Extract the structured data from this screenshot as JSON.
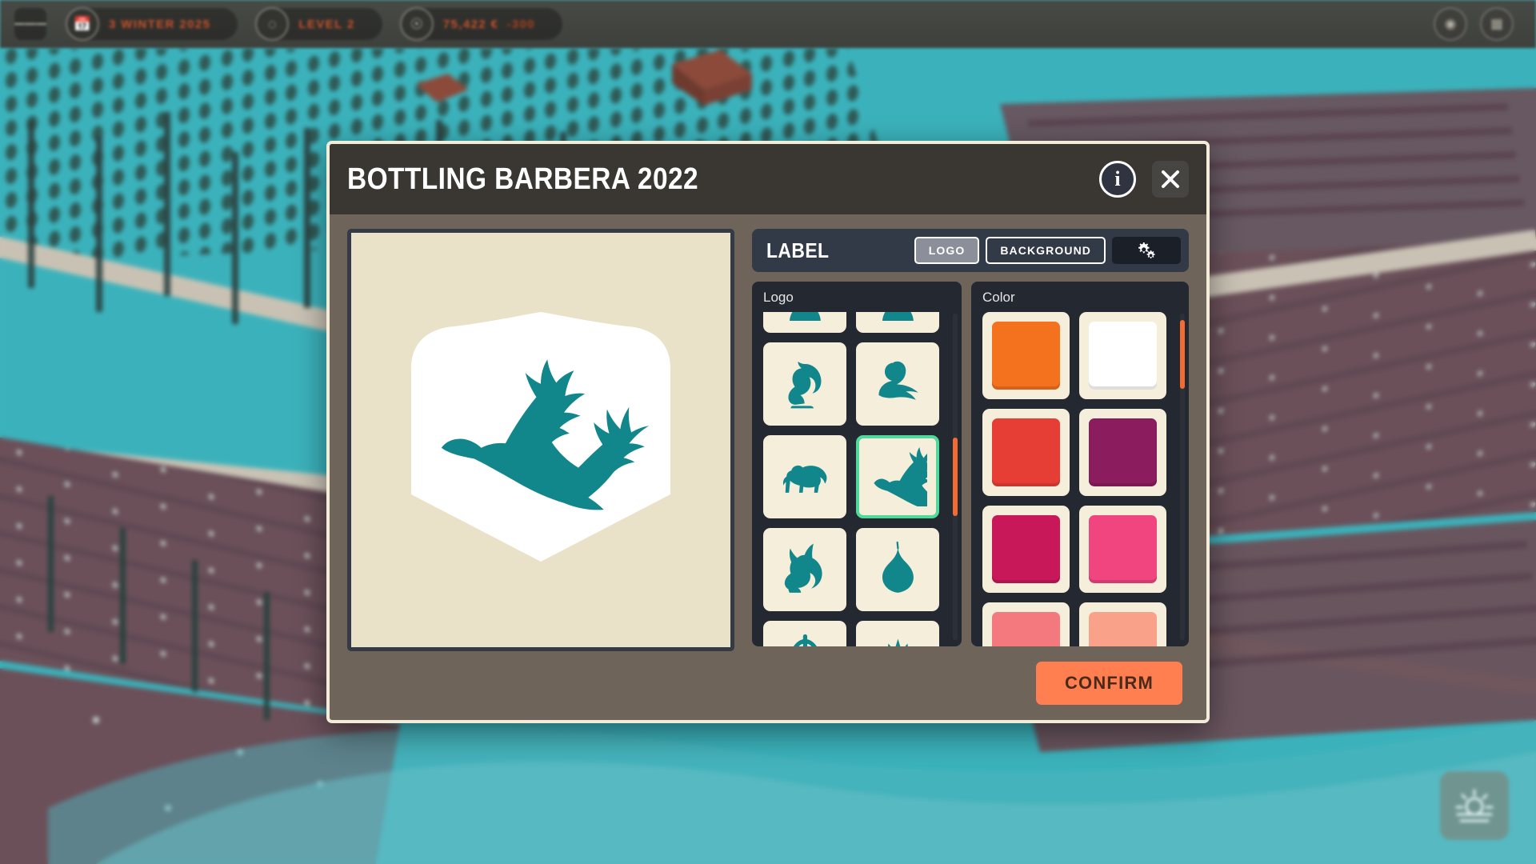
{
  "hud": {
    "menu_icon": "hamburger-menu-icon",
    "chips": [
      {
        "icon": "calendar-icon",
        "text": "3 WINTER 2025",
        "sub": ""
      },
      {
        "icon": "bottle-icon",
        "text": "LEVEL 2",
        "sub": ""
      },
      {
        "icon": "money-icon",
        "text": "75,422 €",
        "sub": "-300"
      }
    ],
    "right_buttons": [
      {
        "icon": "globe-icon"
      },
      {
        "icon": "grid-icon"
      }
    ],
    "weather_icon": "sunrise-icon"
  },
  "dialog": {
    "title": "BOTTLING BARBERA 2022",
    "info_glyph": "i",
    "info_icon": "info-icon",
    "close_icon": "close-icon",
    "confirm_label": "CONFIRM"
  },
  "toolbar": {
    "title": "LABEL",
    "tabs": [
      {
        "label": "LOGO",
        "active": true
      },
      {
        "label": "BACKGROUND",
        "active": false
      }
    ],
    "settings_icon": "gears-icon"
  },
  "logo_panel": {
    "label": "Logo",
    "selected_index": 5,
    "scroll_thumb_top_pct": 38,
    "scroll_thumb_height_pct": 24,
    "items": [
      {
        "name": "leaf-partial-top-left",
        "shape": "leaf-top"
      },
      {
        "name": "leaf-partial-top-right",
        "shape": "leaf-top"
      },
      {
        "name": "squirrel",
        "shape": "squirrel"
      },
      {
        "name": "swan",
        "shape": "swan"
      },
      {
        "name": "bear",
        "shape": "bear"
      },
      {
        "name": "flying-duck",
        "shape": "duck"
      },
      {
        "name": "rabbit",
        "shape": "rabbit"
      },
      {
        "name": "leaf",
        "shape": "leaf"
      },
      {
        "name": "fern-leaf",
        "shape": "fern"
      },
      {
        "name": "maple-leaf",
        "shape": "maple"
      }
    ],
    "ink_color": "#11878c"
  },
  "color_panel": {
    "label": "Color",
    "scroll_thumb_top_pct": 2,
    "scroll_thumb_height_pct": 21,
    "swatches": [
      {
        "name": "orange",
        "hex": "#F4711E"
      },
      {
        "name": "white",
        "hex": "#FFFFFF"
      },
      {
        "name": "red",
        "hex": "#E63E35"
      },
      {
        "name": "purple",
        "hex": "#8B1C5E"
      },
      {
        "name": "magenta",
        "hex": "#C8185A"
      },
      {
        "name": "pink",
        "hex": "#F1457F"
      },
      {
        "name": "salmon",
        "hex": "#F3797F"
      },
      {
        "name": "peach",
        "hex": "#FAA189"
      }
    ]
  },
  "preview": {
    "background_hex": "#E9E1C8",
    "shield_hex": "#FFFFFF",
    "logo_hex": "#11878C",
    "logo_name": "flying-duck"
  },
  "theme": {
    "dialog_body": "#6E6459",
    "dialog_border": "#F2ECD8",
    "titlebar": "#3A3733",
    "panel": "#232831",
    "toolbar": "#323A47",
    "accent_orange": "#FF7F50",
    "selection_green": "#4FD99A",
    "scrollbar": "#F26B33",
    "hud_text": "#C8512A",
    "map_field": "#3BB2BB",
    "map_plot": "#6B5059",
    "map_road": "#C9C2B4"
  }
}
